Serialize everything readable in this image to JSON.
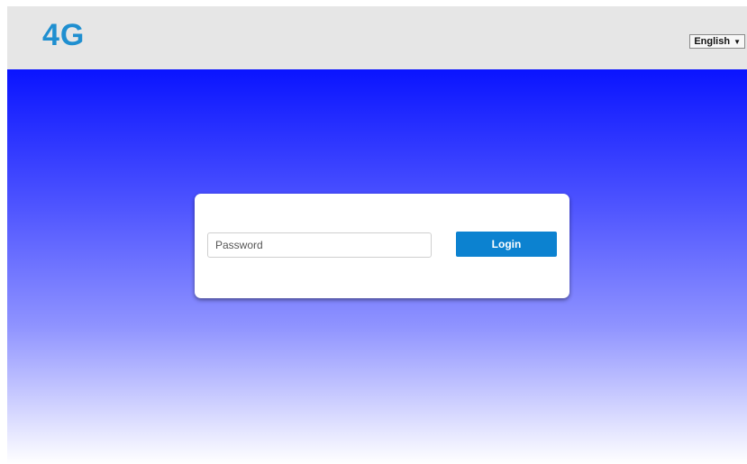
{
  "header": {
    "logo_text": "4G",
    "language": {
      "selected": "English",
      "arrow": "▼"
    }
  },
  "login": {
    "password_placeholder": "Password",
    "password_value": "",
    "login_label": "Login"
  },
  "colors": {
    "brand": "#1f8fd0",
    "button": "#0c82d0",
    "hero_top": "#0a14ff",
    "header_bg": "#e6e6e6"
  }
}
